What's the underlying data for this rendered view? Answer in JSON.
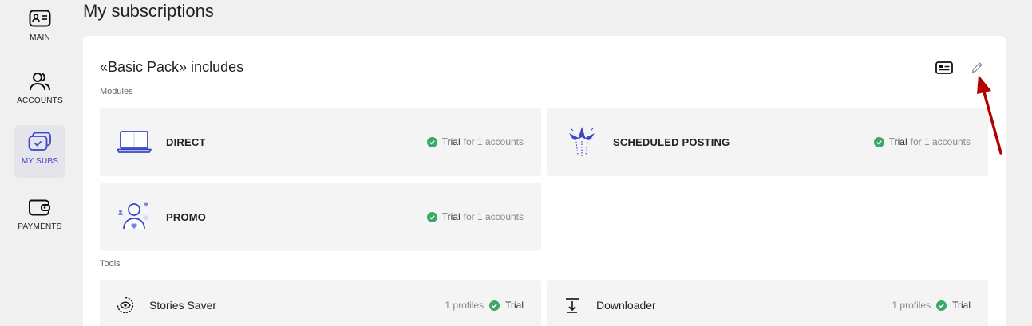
{
  "sidebar": {
    "items": [
      {
        "label": "MAIN",
        "icon": "id-card-icon",
        "active": false
      },
      {
        "label": "ACCOUNTS",
        "icon": "users-icon",
        "active": false
      },
      {
        "label": "MY SUBS",
        "icon": "subscriptions-icon",
        "active": true
      },
      {
        "label": "PAYMENTS",
        "icon": "wallet-icon",
        "active": false
      }
    ]
  },
  "page": {
    "title": "My subscriptions"
  },
  "card": {
    "title": "«Basic Pack» includes",
    "modules_label": "Modules",
    "tools_label": "Tools",
    "modules": [
      {
        "name": "DIRECT",
        "icon": "laptop-icon",
        "status": "Trial",
        "detail": "for 1 accounts"
      },
      {
        "name": "SCHEDULED POSTING",
        "icon": "paper-planes-icon",
        "status": "Trial",
        "detail": "for 1 accounts"
      },
      {
        "name": "PROMO",
        "icon": "person-hearts-icon",
        "status": "Trial",
        "detail": "for 1 accounts"
      }
    ],
    "tools": [
      {
        "name": "Stories Saver",
        "icon": "eye-circle-icon",
        "profiles": "1 profiles",
        "status": "Trial"
      },
      {
        "name": "Downloader",
        "icon": "download-icon",
        "profiles": "1 profiles",
        "status": "Trial"
      }
    ]
  },
  "colors": {
    "accent": "#3b47c8",
    "check_green": "#3aa968",
    "annotation_red": "#b30000"
  }
}
